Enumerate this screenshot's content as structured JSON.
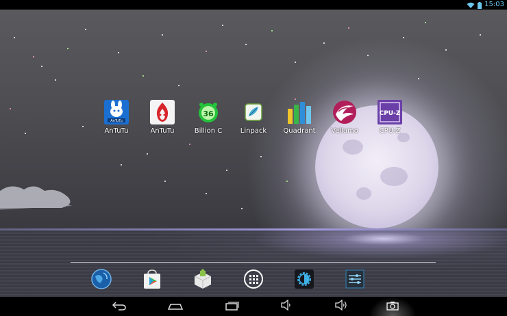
{
  "status_bar": {
    "time": "15:03",
    "icons": [
      "wifi-icon",
      "battery-icon"
    ],
    "accent_color": "#6bc7ef"
  },
  "home": {
    "wallpaper": "night-sky-moon-over-sea",
    "apps": [
      {
        "label": "AnTuTu",
        "icon": "antutu-bunny-icon"
      },
      {
        "label": "AnTuTu",
        "icon": "antutu-flame-icon"
      },
      {
        "label": "Billion C",
        "icon": "billion-counter-icon"
      },
      {
        "label": "Linpack",
        "icon": "linpack-icon"
      },
      {
        "label": "Quadrant",
        "icon": "quadrant-bars-icon"
      },
      {
        "label": "Vellamo",
        "icon": "vellamo-icon"
      },
      {
        "label": "CPU-Z",
        "icon": "cpu-z-icon"
      }
    ]
  },
  "dock": {
    "items": [
      {
        "icon": "browser-globe-icon"
      },
      {
        "icon": "play-store-icon"
      },
      {
        "icon": "installer-box-icon"
      },
      {
        "icon": "all-apps-icon"
      },
      {
        "icon": "brightness-icon"
      },
      {
        "icon": "settings-sliders-icon"
      }
    ]
  },
  "nav_bar": {
    "buttons": [
      {
        "icon": "back-icon"
      },
      {
        "icon": "home-icon"
      },
      {
        "icon": "recent-apps-icon"
      },
      {
        "icon": "volume-down-icon"
      },
      {
        "icon": "volume-up-icon"
      },
      {
        "icon": "screenshot-camera-icon"
      }
    ]
  }
}
